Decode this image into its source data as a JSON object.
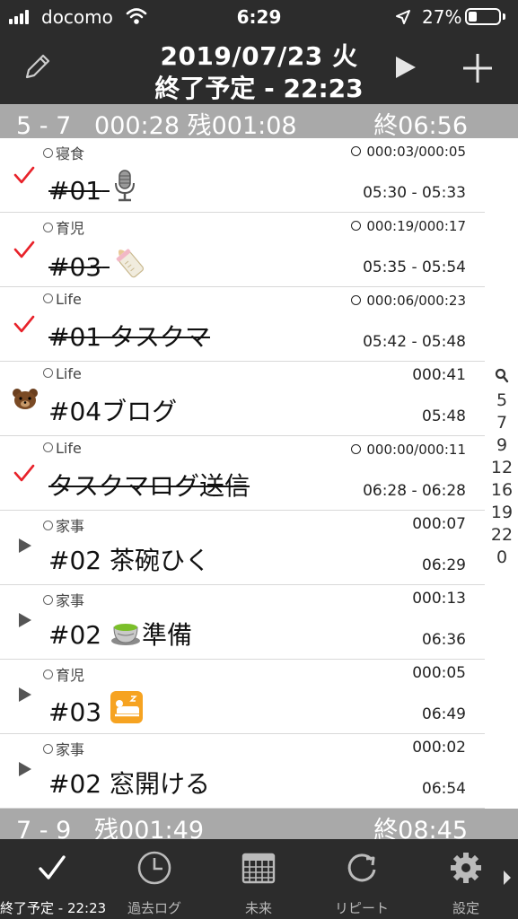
{
  "status_bar": {
    "carrier": "docomo",
    "time": "6:29",
    "battery": "27%",
    "battery_level": 0.27
  },
  "header": {
    "date": "2019/07/23 火",
    "end_planned": "終了予定 - 22:23"
  },
  "sections": [
    {
      "range": "5 - 7",
      "elapsed": "000:28",
      "remaining": "残001:08",
      "end": "終06:56"
    },
    {
      "range": "7 - 9",
      "elapsed": "",
      "remaining": "残001:49",
      "end": "終08:45"
    }
  ],
  "tasks": [
    {
      "category": "寝食",
      "title": "#01",
      "emoji": "microphone",
      "timer": "000:03/000:05",
      "times": "05:30 - 05:33",
      "state": "done"
    },
    {
      "category": "育児",
      "title": "#03",
      "emoji": "baby-bottle",
      "timer": "000:19/000:17",
      "times": "05:35 - 05:54",
      "state": "done"
    },
    {
      "category": "Life",
      "title": "#01 タスクマ",
      "emoji": "",
      "timer": "000:06/000:23",
      "times": "05:42 - 05:48",
      "state": "done"
    },
    {
      "category": "Life",
      "title": "#04ブログ",
      "emoji": "",
      "duration": "000:41",
      "times": "05:48",
      "state": "running"
    },
    {
      "category": "Life",
      "title": "タスクマログ送信",
      "emoji": "",
      "timer": "000:00/000:11",
      "times": "06:28 - 06:28",
      "state": "done"
    },
    {
      "category": "家事",
      "title": "#02 茶碗ひく",
      "emoji": "",
      "duration": "000:07",
      "times": "06:29",
      "state": "pending"
    },
    {
      "category": "家事",
      "title": "#02",
      "title_suffix": "準備",
      "emoji": "green-tea",
      "duration": "000:13",
      "times": "06:36",
      "state": "pending"
    },
    {
      "category": "育児",
      "title": "#03",
      "emoji": "sleeping-tile",
      "duration": "000:05",
      "times": "06:49",
      "state": "pending"
    },
    {
      "category": "家事",
      "title": "#02 窓開ける",
      "emoji": "",
      "duration": "000:02",
      "times": "06:54",
      "state": "pending"
    }
  ],
  "index": [
    "5",
    "7",
    "9",
    "12",
    "16",
    "19",
    "22",
    "0"
  ],
  "tabbar": [
    {
      "label": "終了予定 - 22:23",
      "icon": "check-icon"
    },
    {
      "label": "過去ログ",
      "icon": "clock-icon"
    },
    {
      "label": "未来",
      "icon": "calendar-icon"
    },
    {
      "label": "リピート",
      "icon": "repeat-icon"
    },
    {
      "label": "設定",
      "icon": "gear-icon"
    }
  ],
  "colors": {
    "bar": "#2c2c2c",
    "section": "#a9a9a9",
    "check": "#e8222a"
  }
}
